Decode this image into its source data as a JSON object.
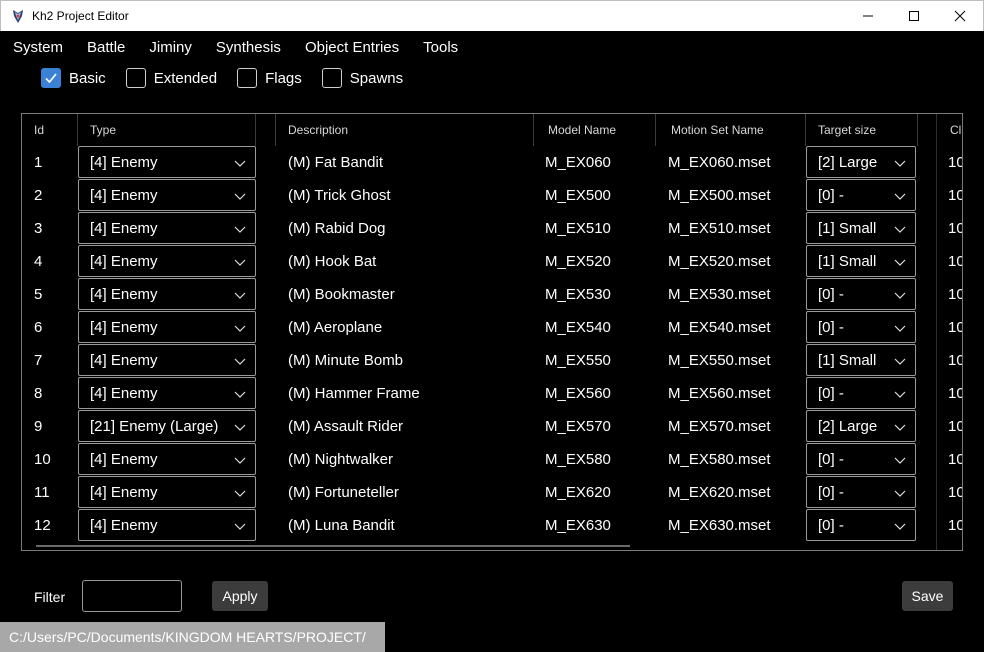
{
  "window": {
    "title": "Kh2 Project Editor"
  },
  "menu": [
    "System",
    "Battle",
    "Jiminy",
    "Synthesis",
    "Object Entries",
    "Tools"
  ],
  "checkboxes": [
    {
      "label": "Basic",
      "checked": true
    },
    {
      "label": "Extended",
      "checked": false
    },
    {
      "label": "Flags",
      "checked": false
    },
    {
      "label": "Spawns",
      "checked": false
    }
  ],
  "table": {
    "headers": {
      "id": "Id",
      "type": "Type",
      "description": "Description",
      "model": "Model Name",
      "motion": "Motion Set Name",
      "target": "Target size",
      "next": "Cl"
    },
    "rows": [
      {
        "id": "1",
        "type": "[4] Enemy",
        "description": "(M) Fat Bandit",
        "model": "M_EX060",
        "motion": "M_EX060.mset",
        "target": "[2] Large",
        "next": "10"
      },
      {
        "id": "2",
        "type": "[4] Enemy",
        "description": "(M) Trick Ghost",
        "model": "M_EX500",
        "motion": "M_EX500.mset",
        "target": "[0] -",
        "next": "10"
      },
      {
        "id": "3",
        "type": "[4] Enemy",
        "description": "(M) Rabid Dog",
        "model": "M_EX510",
        "motion": "M_EX510.mset",
        "target": "[1] Small",
        "next": "10"
      },
      {
        "id": "4",
        "type": "[4] Enemy",
        "description": "(M) Hook Bat",
        "model": "M_EX520",
        "motion": "M_EX520.mset",
        "target": "[1] Small",
        "next": "10"
      },
      {
        "id": "5",
        "type": "[4] Enemy",
        "description": "(M) Bookmaster",
        "model": "M_EX530",
        "motion": "M_EX530.mset",
        "target": "[0] -",
        "next": "10"
      },
      {
        "id": "6",
        "type": "[4] Enemy",
        "description": "(M) Aeroplane",
        "model": "M_EX540",
        "motion": "M_EX540.mset",
        "target": "[0] -",
        "next": "10"
      },
      {
        "id": "7",
        "type": "[4] Enemy",
        "description": "(M) Minute Bomb",
        "model": "M_EX550",
        "motion": "M_EX550.mset",
        "target": "[1] Small",
        "next": "10"
      },
      {
        "id": "8",
        "type": "[4] Enemy",
        "description": "(M) Hammer Frame",
        "model": "M_EX560",
        "motion": "M_EX560.mset",
        "target": "[0] -",
        "next": "10"
      },
      {
        "id": "9",
        "type": "[21] Enemy (Large)",
        "description": "(M) Assault Rider",
        "model": "M_EX570",
        "motion": "M_EX570.mset",
        "target": "[2] Large",
        "next": "10"
      },
      {
        "id": "10",
        "type": "[4] Enemy",
        "description": "(M) Nightwalker",
        "model": "M_EX580",
        "motion": "M_EX580.mset",
        "target": "[0] -",
        "next": "10"
      },
      {
        "id": "11",
        "type": "[4] Enemy",
        "description": "(M) Fortuneteller",
        "model": "M_EX620",
        "motion": "M_EX620.mset",
        "target": "[0] -",
        "next": "10"
      },
      {
        "id": "12",
        "type": "[4] Enemy",
        "description": "(M) Luna Bandit",
        "model": "M_EX630",
        "motion": "M_EX630.mset",
        "target": "[0] -",
        "next": "10"
      }
    ]
  },
  "filter": {
    "label": "Filter",
    "value": "",
    "apply_label": "Apply"
  },
  "save_label": "Save",
  "status": {
    "path": "C:/Users/PC/Documents/KINGDOM HEARTS/PROJECT/"
  },
  "colors": {
    "accent": "#3b82d6",
    "background": "#000000",
    "status_bar": "#a8a8a8"
  }
}
